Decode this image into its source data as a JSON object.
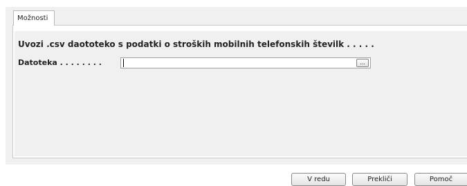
{
  "tabs": [
    {
      "label": "Možnosti"
    }
  ],
  "section": {
    "heading": "Uvozi .csv daototeko s podatki o stroških mobilnih telefonskih številk . . . . ."
  },
  "file_field": {
    "label": "Datoteka . . . . . . . .",
    "value": "",
    "browse_label": "..."
  },
  "footer": {
    "ok_label": "V redu",
    "cancel_label": "Prekliči",
    "help_label": "Pomoč"
  }
}
